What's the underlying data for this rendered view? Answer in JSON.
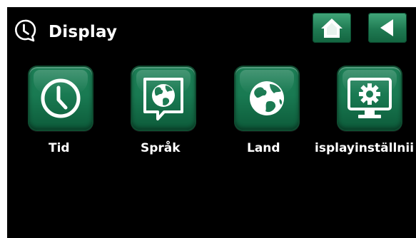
{
  "header": {
    "icon": "clock-speech-icon",
    "title": "Display"
  },
  "nav": {
    "home_icon": "home-icon",
    "back_icon": "back-arrow-icon"
  },
  "tiles": [
    {
      "label": "Tid",
      "icon": "clock-icon"
    },
    {
      "label": "Språk",
      "icon": "globe-speech-bubble-icon"
    },
    {
      "label": "Land",
      "icon": "globe-icon"
    },
    {
      "label": "isplayinställnii",
      "icon": "monitor-gear-icon"
    }
  ],
  "colors": {
    "background": "#000000",
    "tile_green": "#197a52",
    "text": "#ffffff"
  }
}
